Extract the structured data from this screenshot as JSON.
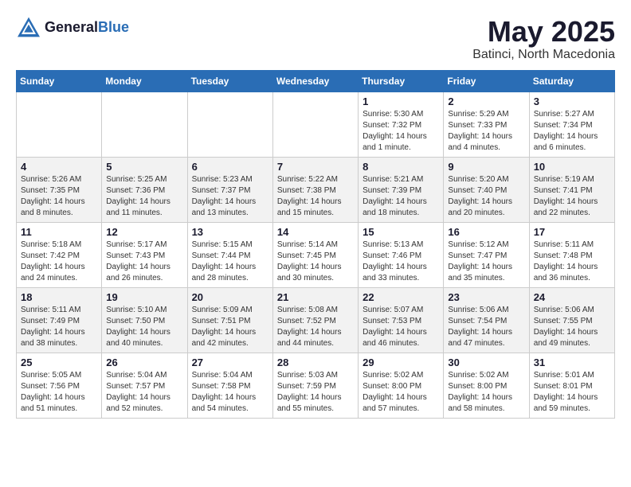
{
  "header": {
    "logo_general": "General",
    "logo_blue": "Blue",
    "month_title": "May 2025",
    "subtitle": "Batinci, North Macedonia"
  },
  "days_of_week": [
    "Sunday",
    "Monday",
    "Tuesday",
    "Wednesday",
    "Thursday",
    "Friday",
    "Saturday"
  ],
  "weeks": [
    [
      {
        "day": "",
        "info": ""
      },
      {
        "day": "",
        "info": ""
      },
      {
        "day": "",
        "info": ""
      },
      {
        "day": "",
        "info": ""
      },
      {
        "day": "1",
        "info": "Sunrise: 5:30 AM\nSunset: 7:32 PM\nDaylight: 14 hours\nand 1 minute."
      },
      {
        "day": "2",
        "info": "Sunrise: 5:29 AM\nSunset: 7:33 PM\nDaylight: 14 hours\nand 4 minutes."
      },
      {
        "day": "3",
        "info": "Sunrise: 5:27 AM\nSunset: 7:34 PM\nDaylight: 14 hours\nand 6 minutes."
      }
    ],
    [
      {
        "day": "4",
        "info": "Sunrise: 5:26 AM\nSunset: 7:35 PM\nDaylight: 14 hours\nand 8 minutes."
      },
      {
        "day": "5",
        "info": "Sunrise: 5:25 AM\nSunset: 7:36 PM\nDaylight: 14 hours\nand 11 minutes."
      },
      {
        "day": "6",
        "info": "Sunrise: 5:23 AM\nSunset: 7:37 PM\nDaylight: 14 hours\nand 13 minutes."
      },
      {
        "day": "7",
        "info": "Sunrise: 5:22 AM\nSunset: 7:38 PM\nDaylight: 14 hours\nand 15 minutes."
      },
      {
        "day": "8",
        "info": "Sunrise: 5:21 AM\nSunset: 7:39 PM\nDaylight: 14 hours\nand 18 minutes."
      },
      {
        "day": "9",
        "info": "Sunrise: 5:20 AM\nSunset: 7:40 PM\nDaylight: 14 hours\nand 20 minutes."
      },
      {
        "day": "10",
        "info": "Sunrise: 5:19 AM\nSunset: 7:41 PM\nDaylight: 14 hours\nand 22 minutes."
      }
    ],
    [
      {
        "day": "11",
        "info": "Sunrise: 5:18 AM\nSunset: 7:42 PM\nDaylight: 14 hours\nand 24 minutes."
      },
      {
        "day": "12",
        "info": "Sunrise: 5:17 AM\nSunset: 7:43 PM\nDaylight: 14 hours\nand 26 minutes."
      },
      {
        "day": "13",
        "info": "Sunrise: 5:15 AM\nSunset: 7:44 PM\nDaylight: 14 hours\nand 28 minutes."
      },
      {
        "day": "14",
        "info": "Sunrise: 5:14 AM\nSunset: 7:45 PM\nDaylight: 14 hours\nand 30 minutes."
      },
      {
        "day": "15",
        "info": "Sunrise: 5:13 AM\nSunset: 7:46 PM\nDaylight: 14 hours\nand 33 minutes."
      },
      {
        "day": "16",
        "info": "Sunrise: 5:12 AM\nSunset: 7:47 PM\nDaylight: 14 hours\nand 35 minutes."
      },
      {
        "day": "17",
        "info": "Sunrise: 5:11 AM\nSunset: 7:48 PM\nDaylight: 14 hours\nand 36 minutes."
      }
    ],
    [
      {
        "day": "18",
        "info": "Sunrise: 5:11 AM\nSunset: 7:49 PM\nDaylight: 14 hours\nand 38 minutes."
      },
      {
        "day": "19",
        "info": "Sunrise: 5:10 AM\nSunset: 7:50 PM\nDaylight: 14 hours\nand 40 minutes."
      },
      {
        "day": "20",
        "info": "Sunrise: 5:09 AM\nSunset: 7:51 PM\nDaylight: 14 hours\nand 42 minutes."
      },
      {
        "day": "21",
        "info": "Sunrise: 5:08 AM\nSunset: 7:52 PM\nDaylight: 14 hours\nand 44 minutes."
      },
      {
        "day": "22",
        "info": "Sunrise: 5:07 AM\nSunset: 7:53 PM\nDaylight: 14 hours\nand 46 minutes."
      },
      {
        "day": "23",
        "info": "Sunrise: 5:06 AM\nSunset: 7:54 PM\nDaylight: 14 hours\nand 47 minutes."
      },
      {
        "day": "24",
        "info": "Sunrise: 5:06 AM\nSunset: 7:55 PM\nDaylight: 14 hours\nand 49 minutes."
      }
    ],
    [
      {
        "day": "25",
        "info": "Sunrise: 5:05 AM\nSunset: 7:56 PM\nDaylight: 14 hours\nand 51 minutes."
      },
      {
        "day": "26",
        "info": "Sunrise: 5:04 AM\nSunset: 7:57 PM\nDaylight: 14 hours\nand 52 minutes."
      },
      {
        "day": "27",
        "info": "Sunrise: 5:04 AM\nSunset: 7:58 PM\nDaylight: 14 hours\nand 54 minutes."
      },
      {
        "day": "28",
        "info": "Sunrise: 5:03 AM\nSunset: 7:59 PM\nDaylight: 14 hours\nand 55 minutes."
      },
      {
        "day": "29",
        "info": "Sunrise: 5:02 AM\nSunset: 8:00 PM\nDaylight: 14 hours\nand 57 minutes."
      },
      {
        "day": "30",
        "info": "Sunrise: 5:02 AM\nSunset: 8:00 PM\nDaylight: 14 hours\nand 58 minutes."
      },
      {
        "day": "31",
        "info": "Sunrise: 5:01 AM\nSunset: 8:01 PM\nDaylight: 14 hours\nand 59 minutes."
      }
    ]
  ]
}
